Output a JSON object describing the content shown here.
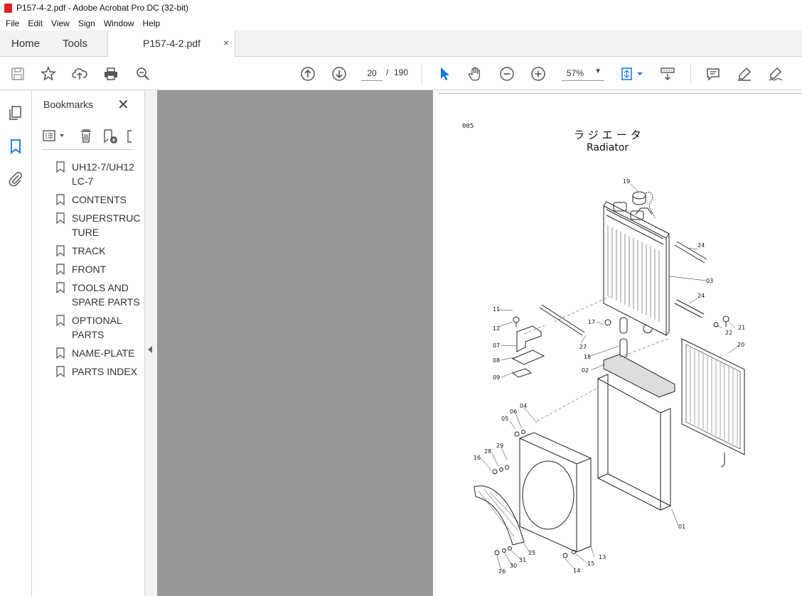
{
  "window": {
    "title": "P157-4-2.pdf - Adobe Acrobat Pro DC (32-bit)"
  },
  "menu": [
    "File",
    "Edit",
    "View",
    "Sign",
    "Window",
    "Help"
  ],
  "tabs": {
    "home": "Home",
    "tools": "Tools",
    "document": "P157-4-2.pdf",
    "close": "×"
  },
  "toolbar": {
    "page_current": "20",
    "page_separator": "/",
    "page_total": "190",
    "zoom": "57%",
    "icons": [
      "save-icon",
      "bookmark-star-icon",
      "upload-icon",
      "print-icon",
      "search-zoom-icon",
      "prev-page-icon",
      "next-page-icon",
      "select-cursor-icon",
      "hand-icon",
      "zoom-out-icon",
      "zoom-in-icon",
      "fit-page-icon",
      "scroll-mode-icon",
      "comment-icon",
      "highlight-icon",
      "sign-icon"
    ]
  },
  "bookmarks": {
    "title": "Bookmarks",
    "close": "✕",
    "items": [
      {
        "label": "UH12-7/UH12 LC-7"
      },
      {
        "label": "CONTENTS"
      },
      {
        "label": "SUPERSTRUC TURE"
      },
      {
        "label": "TRACK"
      },
      {
        "label": "FRONT"
      },
      {
        "label": "TOOLS AND SPARE PARTS"
      },
      {
        "label": "OPTIONAL PARTS"
      },
      {
        "label": "NAME-PLATE"
      },
      {
        "label": "PARTS INDEX"
      }
    ]
  },
  "document_page": {
    "page_code": "005",
    "title_jp": "ラジエータ",
    "title_en": "Radiator",
    "callouts": [
      "19",
      "24",
      "03",
      "24",
      "11",
      "12",
      "17",
      "22",
      "21",
      "27",
      "20",
      "07",
      "18",
      "08",
      "02",
      "09",
      "04",
      "06",
      "05",
      "29",
      "28",
      "16",
      "01",
      "25",
      "31",
      "30",
      "26",
      "15",
      "13",
      "14"
    ]
  },
  "colors": {
    "accent": "#1473e6",
    "gray_area": "#989898",
    "title_icon": "#e3241b"
  }
}
